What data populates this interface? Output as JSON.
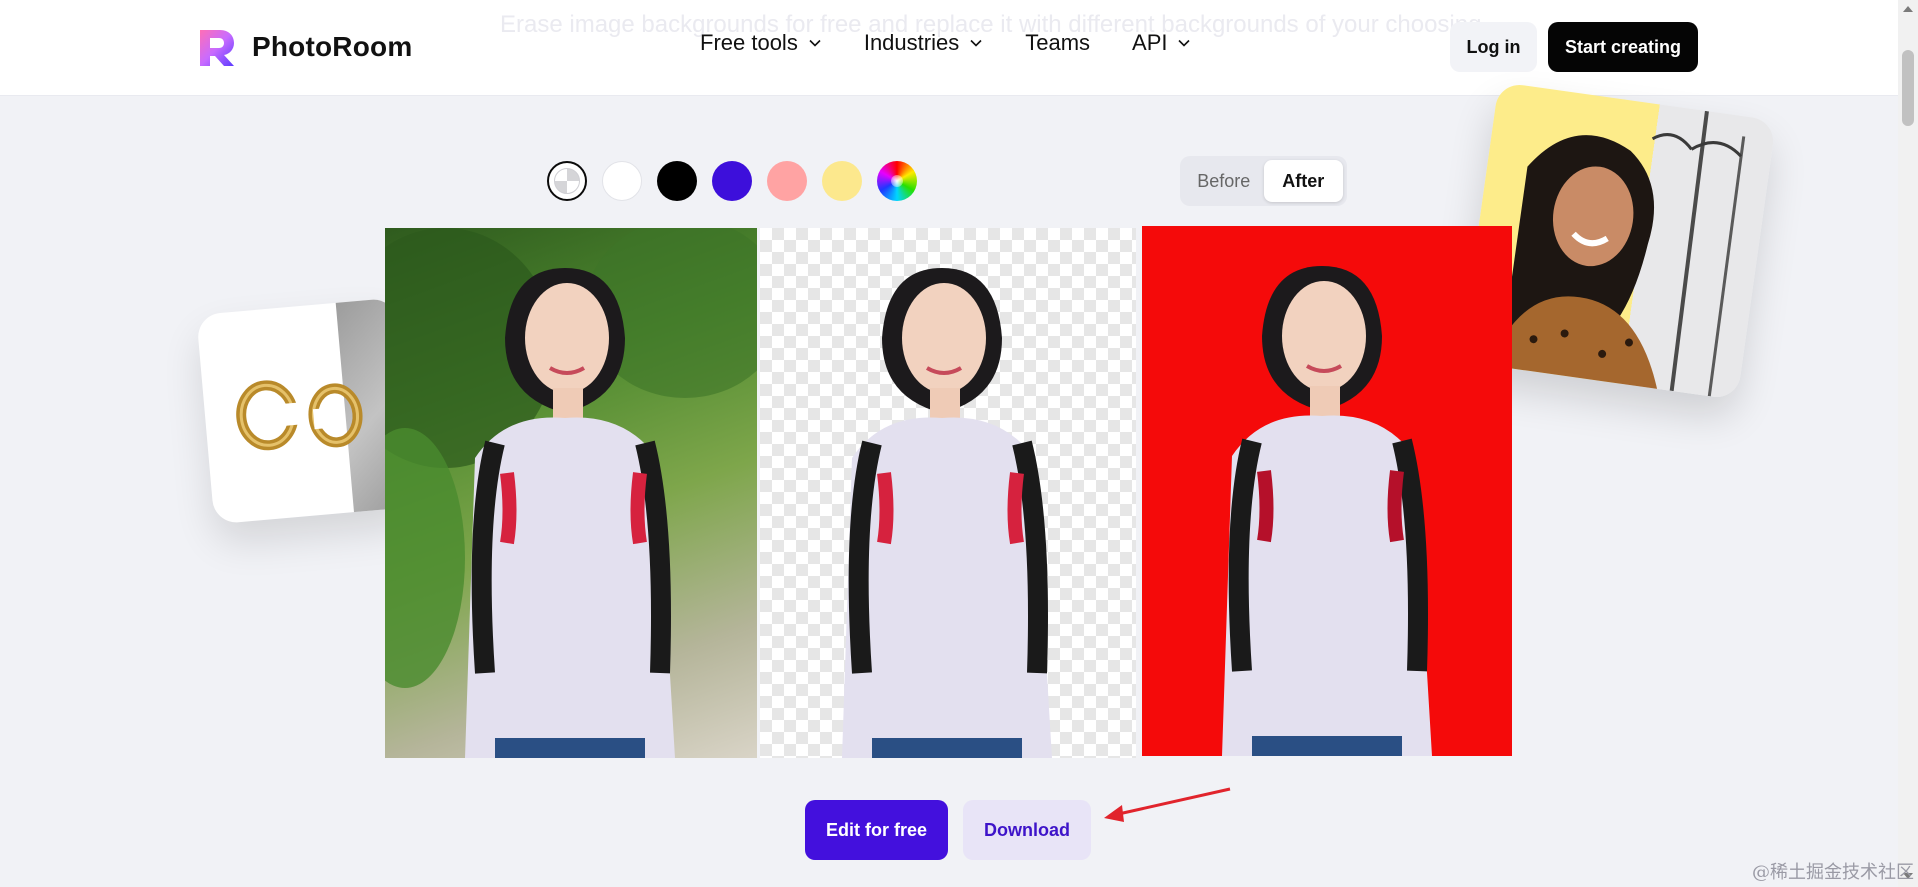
{
  "header": {
    "ghost_text": "Erase image backgrounds for free and replace it with different backgrounds of your choosing.",
    "logo_text": "PhotoRoom",
    "nav": [
      {
        "label": "Free tools",
        "has_dropdown": true
      },
      {
        "label": "Industries",
        "has_dropdown": true
      },
      {
        "label": "Teams",
        "has_dropdown": false
      },
      {
        "label": "API",
        "has_dropdown": true
      }
    ],
    "login_label": "Log in",
    "start_label": "Start creating"
  },
  "swatches": [
    {
      "name": "transparent",
      "color": "transparent"
    },
    {
      "name": "white",
      "color": "#ffffff"
    },
    {
      "name": "black",
      "color": "#000000"
    },
    {
      "name": "purple",
      "color": "#3d0fdb"
    },
    {
      "name": "pink",
      "color": "#ffa3a3"
    },
    {
      "name": "yellow",
      "color": "#fce88d"
    },
    {
      "name": "rainbow",
      "color": "multicolor"
    }
  ],
  "toggle": {
    "before_label": "Before",
    "after_label": "After",
    "selected": "After"
  },
  "panels": {
    "red_background": "#f50a0a"
  },
  "actions": {
    "edit_label": "Edit for free",
    "download_label": "Download"
  },
  "colors": {
    "accent": "#4310dd",
    "download_bg": "#e8e4f7",
    "annotation_arrow": "#e1242c"
  },
  "watermark": "@稀土掘金技术社区"
}
